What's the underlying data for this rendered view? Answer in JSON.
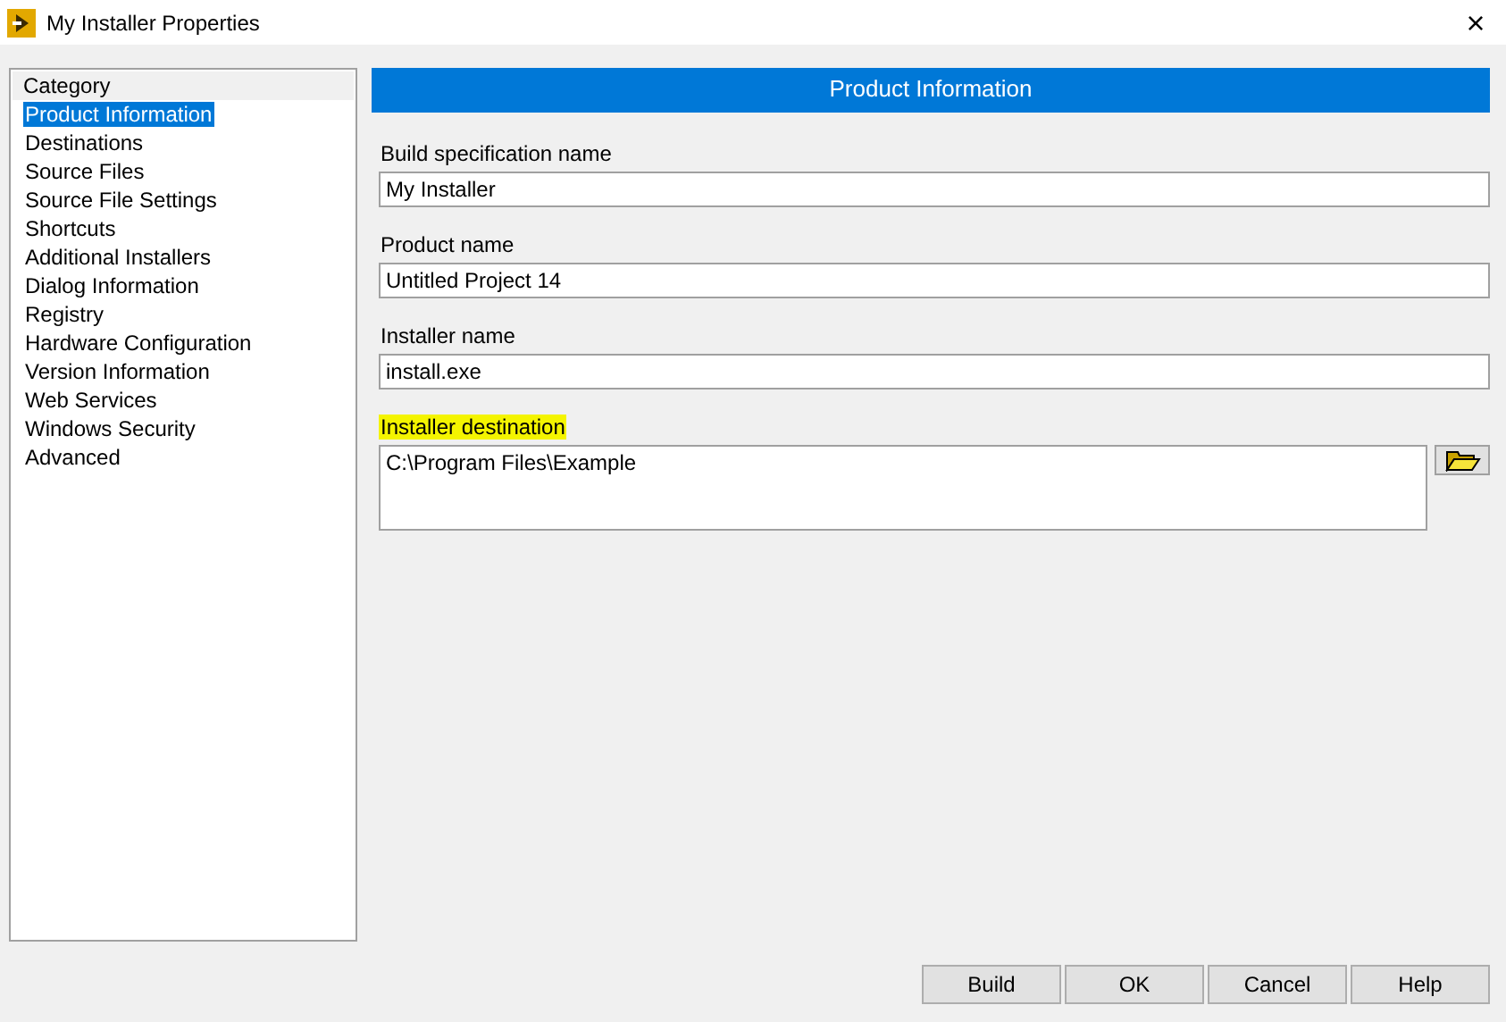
{
  "window": {
    "title": "My Installer Properties",
    "close": "×"
  },
  "sidebar": {
    "heading": "Category",
    "items": [
      {
        "label": "Product Information",
        "selected": true
      },
      {
        "label": "Destinations",
        "selected": false
      },
      {
        "label": "Source Files",
        "selected": false
      },
      {
        "label": "Source File Settings",
        "selected": false
      },
      {
        "label": "Shortcuts",
        "selected": false
      },
      {
        "label": "Additional Installers",
        "selected": false
      },
      {
        "label": "Dialog Information",
        "selected": false
      },
      {
        "label": "Registry",
        "selected": false
      },
      {
        "label": "Hardware Configuration",
        "selected": false
      },
      {
        "label": "Version Information",
        "selected": false
      },
      {
        "label": "Web Services",
        "selected": false
      },
      {
        "label": "Windows Security",
        "selected": false
      },
      {
        "label": "Advanced",
        "selected": false
      }
    ]
  },
  "panel": {
    "title": "Product Information",
    "fields": [
      {
        "kind": "text",
        "label": "Build specification name",
        "value": "My Installer",
        "highlighted": false
      },
      {
        "kind": "text",
        "label": "Product name",
        "value": "Untitled Project 14",
        "highlighted": false
      },
      {
        "kind": "text",
        "label": "Installer name",
        "value": "install.exe",
        "highlighted": false
      },
      {
        "kind": "path",
        "label": "Installer destination",
        "value": "C:\\Program Files\\Example",
        "highlighted": true
      }
    ]
  },
  "buttons": [
    "Build",
    "OK",
    "Cancel",
    "Help"
  ]
}
